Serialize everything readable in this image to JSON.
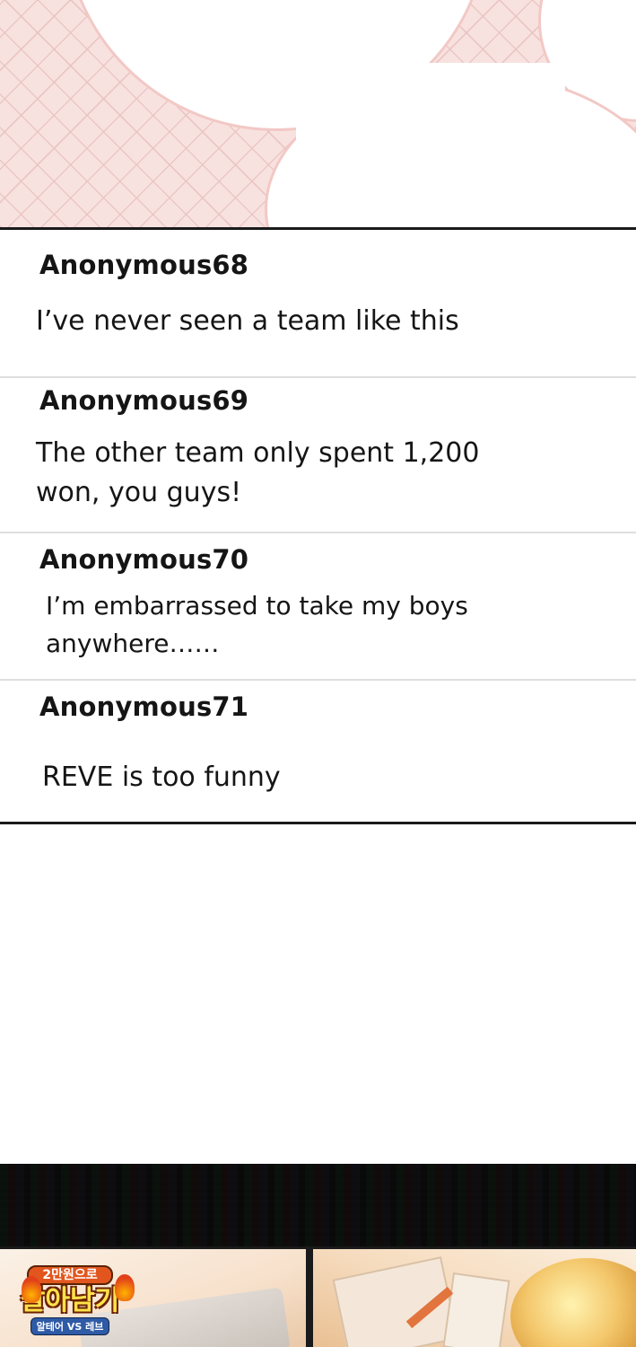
{
  "comments": [
    {
      "user": "Anonymous68",
      "text": "I’ve never seen a team like this"
    },
    {
      "user": "Anonymous69",
      "text": "The other team only spent 1,200 won, you guys!"
    },
    {
      "user": "Anonymous70",
      "text": "I’m embarrassed to take my boys anywhere……"
    },
    {
      "user": "Anonymous71",
      "text": "REVE is too funny"
    }
  ],
  "logo": {
    "line1": "2만원으로",
    "line2": "살아남기",
    "line3": "알테어 VS 레브"
  },
  "colors": {
    "banner_pink": "#f8e2e0",
    "divider": "#1a1a1a",
    "logo_orange": "#e2561e",
    "logo_yellow": "#ffe24a",
    "logo_blue": "#2e5aa6"
  }
}
